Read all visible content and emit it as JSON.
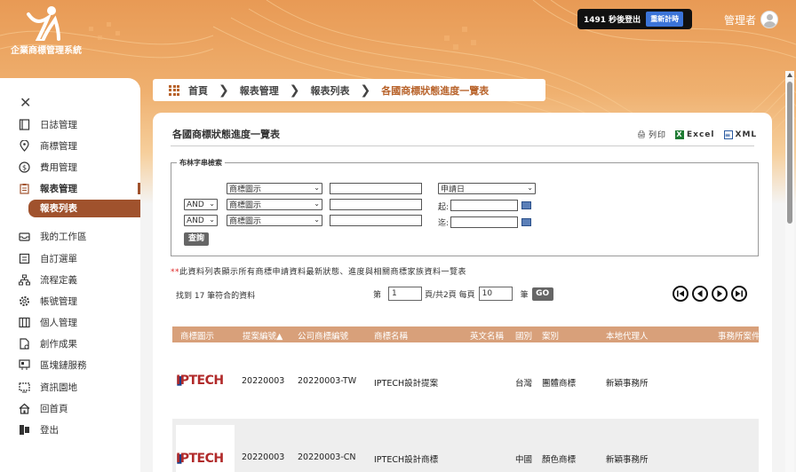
{
  "header": {
    "logo_text": "企業商標管理系統",
    "session_text": "1491 秒後登出",
    "renew_label": "重新計時",
    "user_label": "管理者"
  },
  "sidebar": {
    "items": [
      {
        "label": "日誌管理",
        "icon": "book-icon"
      },
      {
        "label": "商標管理",
        "icon": "pin-icon"
      },
      {
        "label": "費用管理",
        "icon": "dollar-icon"
      },
      {
        "label": "報表管理",
        "icon": "clipboard-icon"
      },
      {
        "label": "報表列表",
        "icon": ""
      },
      {
        "label": "我的工作區",
        "icon": "inbox-icon"
      },
      {
        "label": "自訂選單",
        "icon": "list-icon"
      },
      {
        "label": "流程定義",
        "icon": "flow-icon"
      },
      {
        "label": "帳號管理",
        "icon": "gear-icon"
      },
      {
        "label": "個人管理",
        "icon": "columns-icon"
      },
      {
        "label": "創作成果",
        "icon": "document-icon"
      },
      {
        "label": "區塊鏈服務",
        "icon": "block-icon"
      },
      {
        "label": "資訊園地",
        "icon": "screen-icon"
      },
      {
        "label": "回首頁",
        "icon": "home-icon"
      },
      {
        "label": "登出",
        "icon": "logout-icon"
      }
    ]
  },
  "breadcrumb": {
    "items": [
      "首頁",
      "報表管理",
      "報表列表",
      "各國商標狀態進度一覽表"
    ]
  },
  "panel": {
    "title": "各國商標狀態進度一覽表",
    "export_print": "列印",
    "export_excel": "Excel",
    "export_xml": "XML"
  },
  "search": {
    "legend": "布林字串檢索",
    "field_1": "商標圖示",
    "field_2": "商標圖示",
    "field_3": "商標圖示",
    "op_2": "AND",
    "op_3": "AND",
    "date_field": "申請日",
    "from_label": "起:",
    "to_label": "迄:",
    "query_label": "查詢"
  },
  "note": {
    "star": "**",
    "text": "此資料列表顯示所有商標申請資料最新狀態、進度與相關商標家族資料一覽表"
  },
  "pagination": {
    "found": "找到 17 筆符合的資料",
    "page_prefix": "第",
    "page_value": "1",
    "page_suffix": "頁/共2頁 每頁",
    "per_page_value": "10",
    "per_page_suffix": "筆",
    "go_label": "GO"
  },
  "table": {
    "columns": [
      "商標圖示",
      "提案編號▲",
      "公司商標編號",
      "商標名稱",
      "英文名稱",
      "國別",
      "案別",
      "本地代理人",
      "事務所案件"
    ],
    "rows": [
      {
        "logo": "IPTECH",
        "proposal": "20220003",
        "company_no": "20220003-TW",
        "name": "IPTECH設計提案",
        "english": "",
        "country": "台灣",
        "type": "團體商標",
        "agent": "新穎事務所"
      },
      {
        "logo": "IPTECH",
        "proposal": "20220003",
        "company_no": "20220003-CN",
        "name": "IPTECH設計商標",
        "english": "",
        "country": "中國",
        "type": "顏色商標",
        "agent": "新穎事務所"
      }
    ]
  }
}
